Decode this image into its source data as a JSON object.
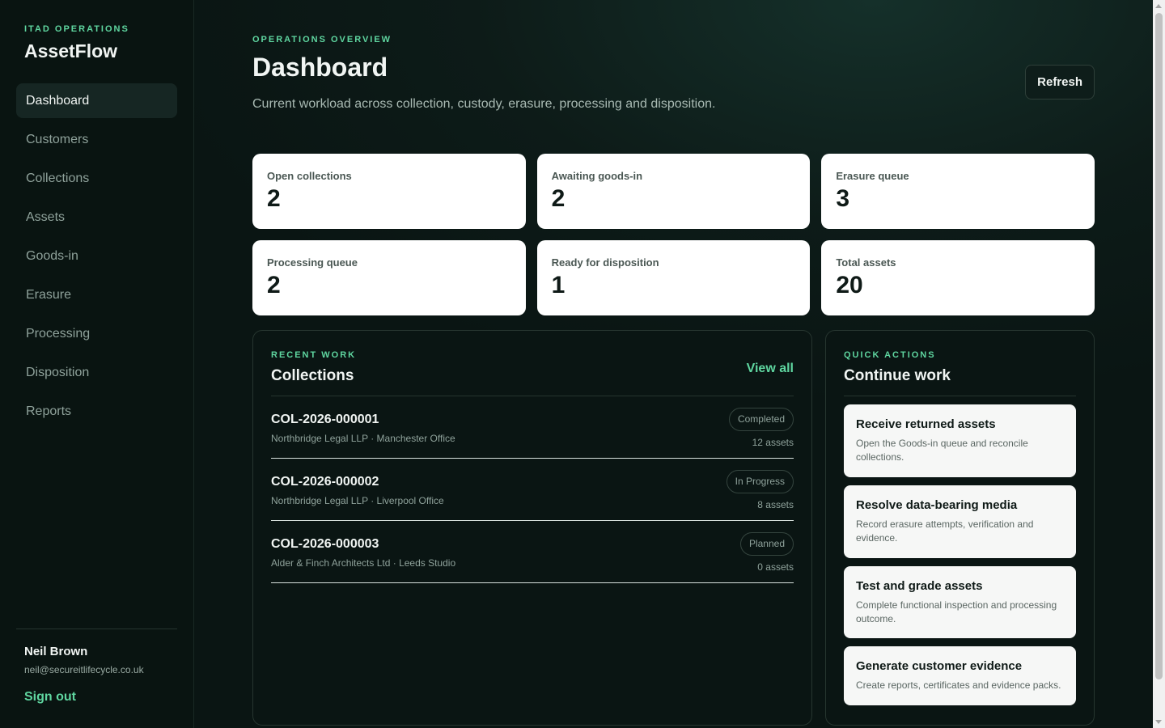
{
  "sidebar": {
    "eyebrow": "ITAD OPERATIONS",
    "brand": "AssetFlow",
    "nav": [
      {
        "label": "Dashboard",
        "active": true
      },
      {
        "label": "Customers"
      },
      {
        "label": "Collections"
      },
      {
        "label": "Assets"
      },
      {
        "label": "Goods-in"
      },
      {
        "label": "Erasure"
      },
      {
        "label": "Processing"
      },
      {
        "label": "Disposition"
      },
      {
        "label": "Reports"
      }
    ],
    "user": {
      "name": "Neil Brown",
      "email": "neil@secureitlifecycle.co.uk"
    },
    "signout": "Sign out"
  },
  "header": {
    "eyebrow": "OPERATIONS OVERVIEW",
    "title": "Dashboard",
    "subtitle": "Current workload across collection, custody, erasure, processing and disposition.",
    "refresh": "Refresh"
  },
  "stats": [
    {
      "label": "Open collections",
      "value": "2"
    },
    {
      "label": "Awaiting goods-in",
      "value": "2"
    },
    {
      "label": "Erasure queue",
      "value": "3"
    },
    {
      "label": "Processing queue",
      "value": "2"
    },
    {
      "label": "Ready for disposition",
      "value": "1"
    },
    {
      "label": "Total assets",
      "value": "20"
    }
  ],
  "recent": {
    "eyebrow": "RECENT WORK",
    "title": "Collections",
    "view_all": "View all",
    "rows": [
      {
        "id": "COL-2026-000001",
        "sub": "Northbridge Legal LLP · Manchester Office",
        "status": "Completed",
        "assets": "12 assets"
      },
      {
        "id": "COL-2026-000002",
        "sub": "Northbridge Legal LLP · Liverpool Office",
        "status": "In Progress",
        "assets": "8 assets"
      },
      {
        "id": "COL-2026-000003",
        "sub": "Alder & Finch Architects Ltd · Leeds Studio",
        "status": "Planned",
        "assets": "0 assets"
      }
    ]
  },
  "actions": {
    "eyebrow": "QUICK ACTIONS",
    "title": "Continue work",
    "items": [
      {
        "title": "Receive returned assets",
        "desc": "Open the Goods-in queue and reconcile collections."
      },
      {
        "title": "Resolve data-bearing media",
        "desc": "Record erasure attempts, verification and evidence."
      },
      {
        "title": "Test and grade assets",
        "desc": "Complete functional inspection and processing outcome."
      },
      {
        "title": "Generate customer evidence",
        "desc": "Create reports, certificates and evidence packs."
      }
    ]
  },
  "colors": {
    "accent": "#5fd6a0",
    "background": "#0b1613",
    "card": "#ffffff"
  }
}
